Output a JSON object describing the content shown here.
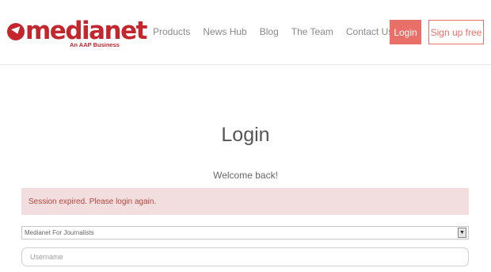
{
  "brand": {
    "name": "medianet",
    "tagline": "An AAP Business",
    "color": "#c4262e"
  },
  "nav": {
    "items": [
      "Products",
      "News Hub",
      "Blog",
      "The Team",
      "Contact Us"
    ]
  },
  "header_buttons": {
    "login": "Login",
    "signup": "Sign up free",
    "accent": "#e87068"
  },
  "main": {
    "title": "Login",
    "welcome": "Welcome back!",
    "alert": "Session expired. Please login again.",
    "alert_bg": "#f2dede",
    "account_select": {
      "selected": "Medianet For Journalists"
    },
    "username": {
      "placeholder": "Username",
      "value": ""
    }
  }
}
